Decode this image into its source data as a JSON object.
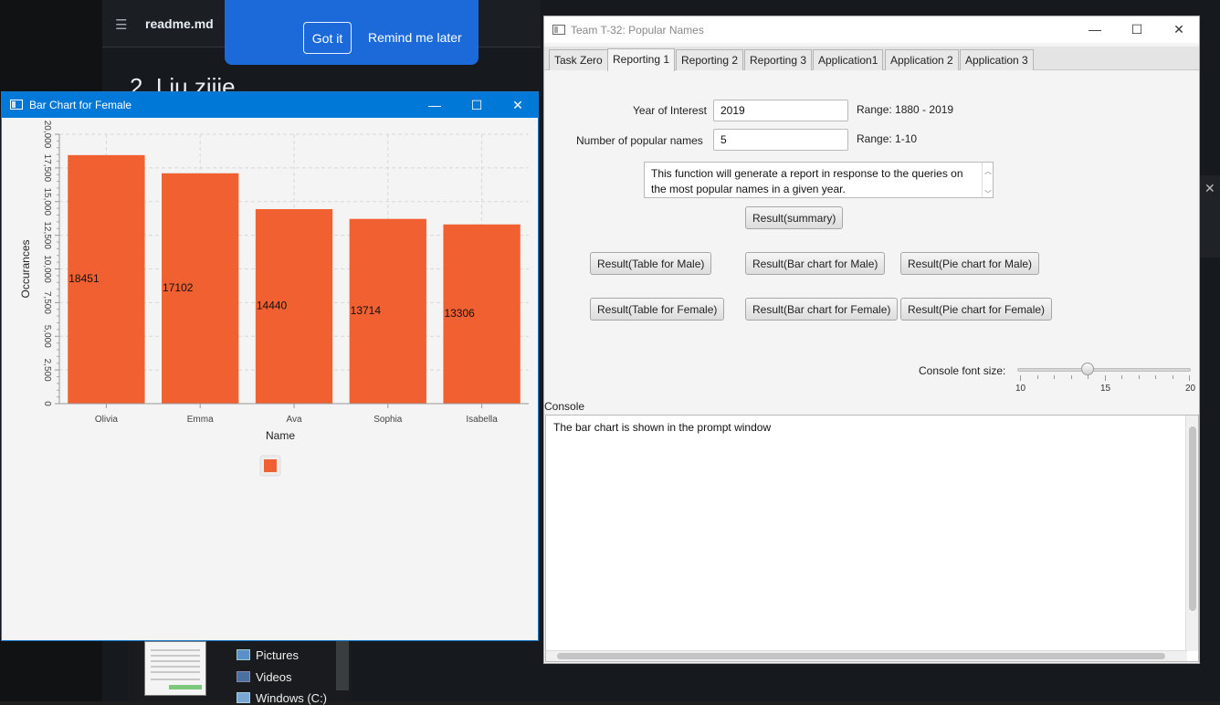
{
  "background": {
    "editor_title": "readme.md",
    "heading": "2. Liu zijie",
    "notification": {
      "got_it": "Got it",
      "remind_later": "Remind me later"
    },
    "explorer_items": [
      "Pictures",
      "Videos",
      "Windows (C:)"
    ]
  },
  "chart_window": {
    "title": "Bar Chart for Female",
    "controls": {
      "minimize": "—",
      "maximize": "☐",
      "close": "✕"
    }
  },
  "chart_data": {
    "type": "bar",
    "categories": [
      "Olivia",
      "Emma",
      "Ava",
      "Sophia",
      "Isabella"
    ],
    "values": [
      18451,
      17102,
      14440,
      13714,
      13306
    ],
    "xlabel": "Name",
    "ylabel": "Occurances",
    "ylim": [
      0,
      20000
    ],
    "yticks": [
      "0",
      "2,500",
      "5,000",
      "7,500",
      "10,000",
      "12,500",
      "15,000",
      "17,500",
      "20,000"
    ],
    "grid": true,
    "legend_placement": "bottom",
    "bar_color": "#f06030"
  },
  "app_window": {
    "title": "Team T-32: Popular Names",
    "controls": {
      "minimize": "—",
      "maximize": "☐",
      "close": "✕"
    },
    "tabs": [
      {
        "label": "Task Zero",
        "active": false
      },
      {
        "label": "Reporting 1",
        "active": true
      },
      {
        "label": "Reporting 2",
        "active": false
      },
      {
        "label": "Reporting 3",
        "active": false
      },
      {
        "label": "Application1",
        "active": false
      },
      {
        "label": "Application 2",
        "active": false
      },
      {
        "label": "Application 3",
        "active": false
      }
    ],
    "form": {
      "year_label": "Year of Interest",
      "year_value": "2019",
      "year_range": "Range: 1880 - 2019",
      "count_label": "Number of popular names",
      "count_value": "5",
      "count_range": "Range: 1-10",
      "description": "This function will generate a report in response to the queries on the most popular names in a given year."
    },
    "buttons": {
      "summary": "Result(summary)",
      "table_male": "Result(Table for Male)",
      "bar_male": "Result(Bar chart for Male)",
      "pie_male": "Result(Pie chart for Male)",
      "table_female": "Result(Table for Female)",
      "bar_female": "Result(Bar chart for Female)",
      "pie_female": "Result(Pie chart for Female)"
    },
    "font_slider": {
      "label": "Console font size:",
      "min": "10",
      "mid": "15",
      "max": "20",
      "value": 14
    },
    "console": {
      "label": "Console",
      "text": "The bar chart is shown in the prompt window"
    }
  }
}
